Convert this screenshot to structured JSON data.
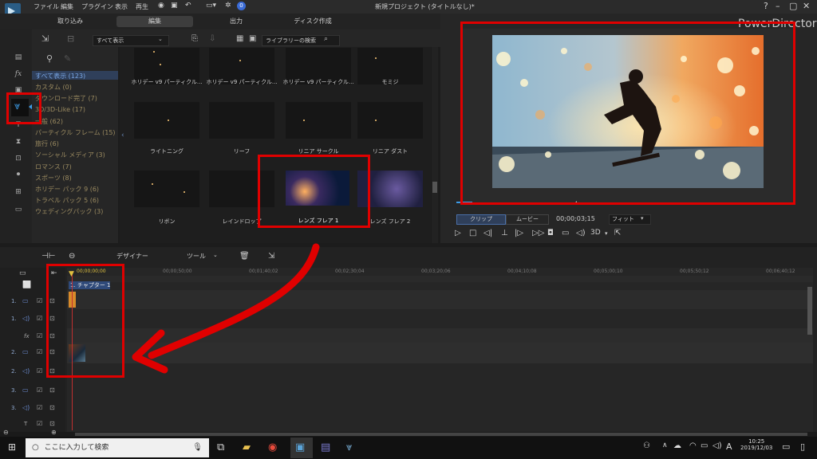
{
  "menu": {
    "file": "ファイル",
    "edit": "編集",
    "plugin": "プラグイン",
    "view": "表示",
    "play": "再生"
  },
  "window_title": "新規プロジェクト (タイトルなし)*",
  "notification_count": "0",
  "tabs": [
    "取り込み",
    "編集",
    "出力",
    "ディスク作成"
  ],
  "brand": "PowerDirector",
  "library": {
    "filter": "すべて表示",
    "search_placeholder": "ライブラリーの検索",
    "categories": [
      "すべて表示 (123)",
      "カスタム (0)",
      "ダウンロード完了 (7)",
      "3D/3D-Like (17)",
      "一般 (62)",
      "パーティクル フレーム (15)",
      "旅行 (6)",
      "ソーシャル メディア (3)",
      "ロマンス (7)",
      "スポーツ (8)",
      "ホリデー パック 9 (6)",
      "トラベル パック 5 (6)",
      "ウェディングパック (3)"
    ],
    "items": [
      "ホリデー v9 パーティクル...",
      "ホリデー v9 パーティクル...",
      "ホリデー v9 パーティクル...",
      "モミジ",
      "ライトニング",
      "リーフ",
      "リニア サークル",
      "リニア ダスト",
      "リボン",
      "レインドロップ",
      "レンズ フレア 1",
      "レンズ フレア 2"
    ]
  },
  "preview": {
    "clip": "クリップ",
    "movie": "ムービー",
    "timecode": "00;00;03;15",
    "fit": "フィット",
    "mode3d": "3D"
  },
  "timeline": {
    "toolbar": {
      "designer": "デザイナー",
      "tools": "ツール"
    },
    "ruler": [
      "00;00;00;00",
      "00;00;50;00",
      "00;01;40;02",
      "00;02;30;04",
      "00;03;20;06",
      "00;04;10;08",
      "00;05;00;10",
      "00;05;50;12",
      "00;06;40;12"
    ],
    "tracks": [
      "1.",
      "1.",
      "fx",
      "2.",
      "2.",
      "3.",
      "3.",
      "T"
    ],
    "chapter": "1. チャプター 1"
  },
  "taskbar": {
    "search": "ここに入力して検索",
    "time": "10:25",
    "date": "2019/12/03",
    "ime": "A"
  },
  "colors": {
    "accent_red": "#e00000",
    "selection_blue": "#2f3f5a"
  }
}
